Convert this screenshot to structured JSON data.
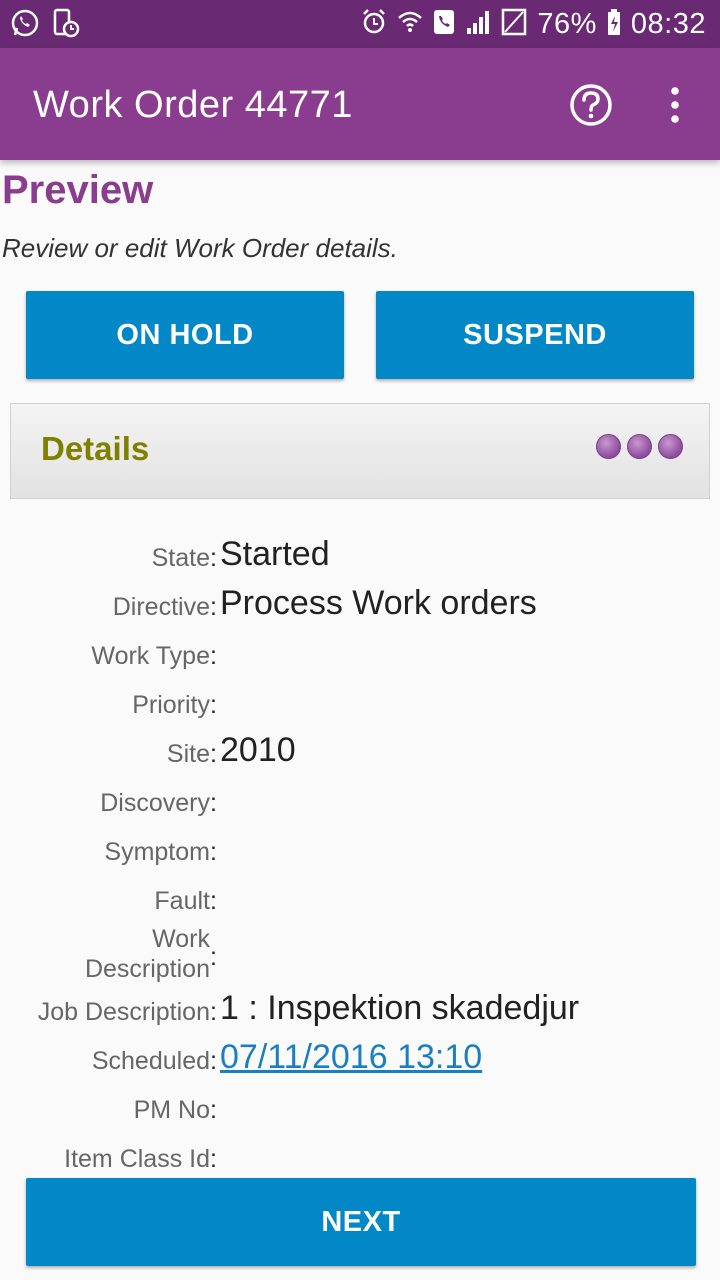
{
  "status_bar": {
    "battery_percent": "76%",
    "time": "08:32",
    "icons_left": [
      "whatsapp-icon",
      "phone-clock-icon"
    ],
    "icons_right": [
      "alarm-icon",
      "wifi-call-icon",
      "call-icon",
      "signal-icon",
      "no-sim-icon",
      "battery-charging-icon"
    ]
  },
  "app_bar": {
    "title": "Work Order 44771",
    "help_icon": "help-circle-icon",
    "menu_icon": "more-vert-icon"
  },
  "preview": {
    "title": "Preview",
    "subtitle": "Review or edit Work Order details."
  },
  "actions": {
    "on_hold": "ON HOLD",
    "suspend": "SUSPEND",
    "next": "NEXT"
  },
  "details": {
    "title": "Details",
    "menu_icon": "three-dots-icon"
  },
  "fields": [
    {
      "label": "State",
      "value": "Started"
    },
    {
      "label": "Directive",
      "value": "Process Work orders"
    },
    {
      "label": "Work Type",
      "value": ""
    },
    {
      "label": "Priority",
      "value": ""
    },
    {
      "label": "Site",
      "value": "2010"
    },
    {
      "label": "Discovery",
      "value": ""
    },
    {
      "label": "Symptom",
      "value": ""
    },
    {
      "label": "Fault",
      "value": ""
    },
    {
      "label": "Work Description",
      "value": ""
    },
    {
      "label": "Job Description",
      "value": "1 : Inspektion skadedjur"
    },
    {
      "label": "Scheduled",
      "value": "07/11/2016 13:10"
    },
    {
      "label": "PM No",
      "value": ""
    },
    {
      "label": "Item Class Id",
      "value": ""
    }
  ],
  "colors": {
    "status_bar": "#6a2a73",
    "app_bar": "#8a3d8e",
    "button": "#0288c7",
    "details_title": "#808000",
    "link": "#1a7fc0"
  }
}
